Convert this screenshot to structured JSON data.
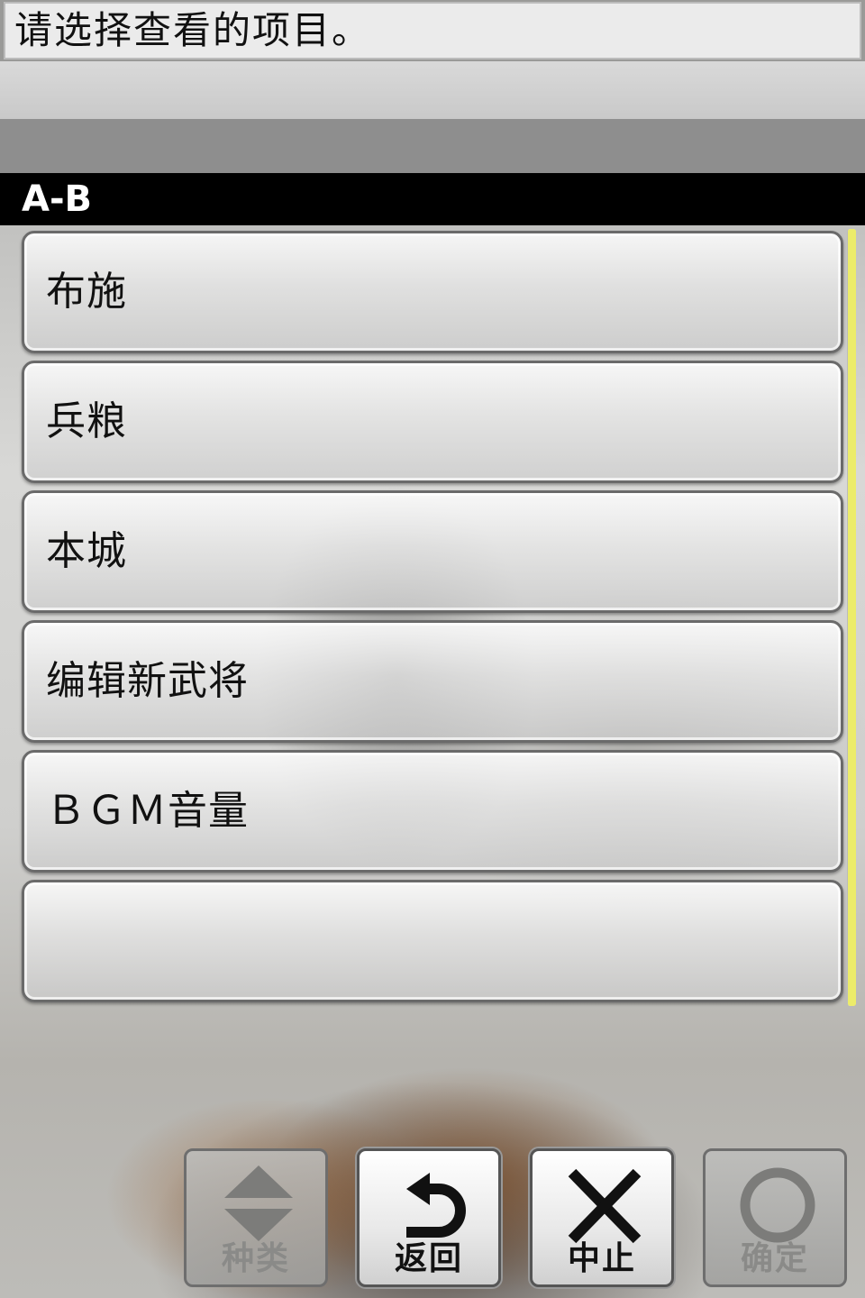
{
  "message": "请选择查看的项目。",
  "section_header": "A-B",
  "items": [
    {
      "label": "布施"
    },
    {
      "label": "兵粮"
    },
    {
      "label": "本城"
    },
    {
      "label": "编辑新武将"
    },
    {
      "label": "ＢＧＭ音量"
    },
    {
      "label": ""
    }
  ],
  "buttons": {
    "category": {
      "label": "种类",
      "icon": "up-down-arrows-icon",
      "enabled": false
    },
    "back": {
      "label": "返回",
      "icon": "return-arrow-icon",
      "enabled": true
    },
    "cancel": {
      "label": "中止",
      "icon": "x-icon",
      "enabled": true
    },
    "confirm": {
      "label": "确定",
      "icon": "circle-icon",
      "enabled": false
    }
  },
  "colors": {
    "header_bg": "#000000",
    "scrollbar": "#ecec6a",
    "text": "#111111"
  }
}
